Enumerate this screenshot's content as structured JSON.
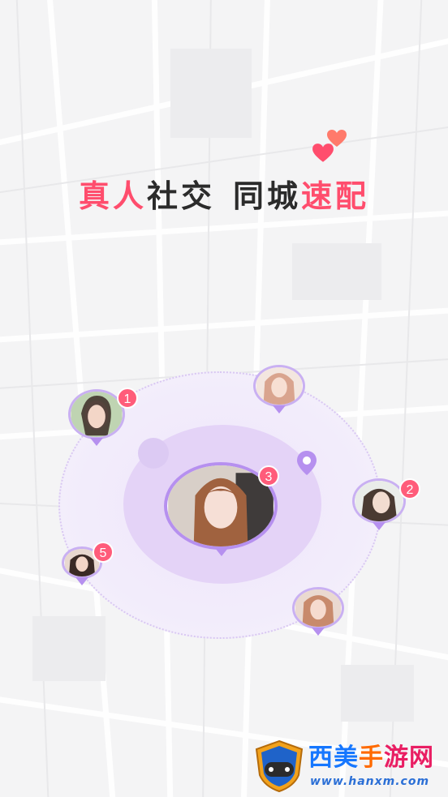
{
  "headline": {
    "part1": "真人",
    "part2": "社交",
    "part3": "同城",
    "part4": "速配"
  },
  "colors": {
    "accent_pink": "#ff4d6d",
    "ring_purple": "#b690ef",
    "badge_red": "#ff5c7a",
    "text_dark": "#2b2b2b"
  },
  "icons": [
    "heart-icon",
    "location-pin-icon"
  ],
  "avatars": [
    {
      "id": "a1",
      "badge": "1"
    },
    {
      "id": "a2",
      "badge": "2"
    },
    {
      "id": "a3",
      "badge": "3"
    },
    {
      "id": "a4",
      "badge": ""
    },
    {
      "id": "a5",
      "badge": "5"
    },
    {
      "id": "a6",
      "badge": ""
    }
  ],
  "watermark": {
    "text_a": "西美",
    "text_b": "手",
    "text_c": "游网",
    "url": "www.hanxm.com"
  }
}
